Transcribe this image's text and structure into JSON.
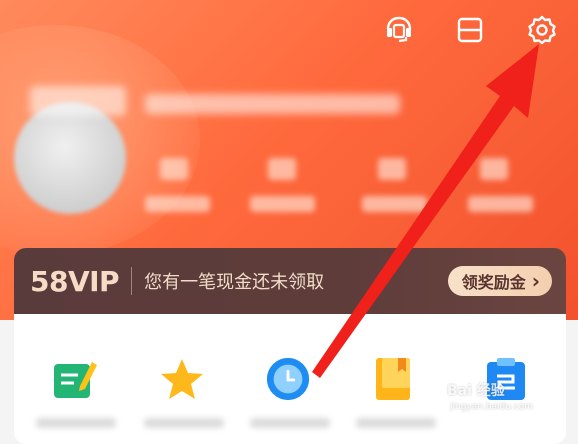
{
  "header": {
    "icons": [
      "customer-service-icon",
      "scan-icon",
      "settings-icon"
    ]
  },
  "vip_banner": {
    "logo": "58VIP",
    "message": "您有一笔现金还未领取",
    "button_label": "领奖励金",
    "button_arrow": "›"
  },
  "quick_apps": {
    "icons": [
      "note-icon",
      "star-icon",
      "clock-icon",
      "book-icon",
      "clipboard-icon"
    ]
  },
  "watermark": {
    "main": "Bai 经验",
    "sub": "jingyan.baidu.com"
  },
  "annotation": {
    "arrow_color": "#f0201a"
  }
}
